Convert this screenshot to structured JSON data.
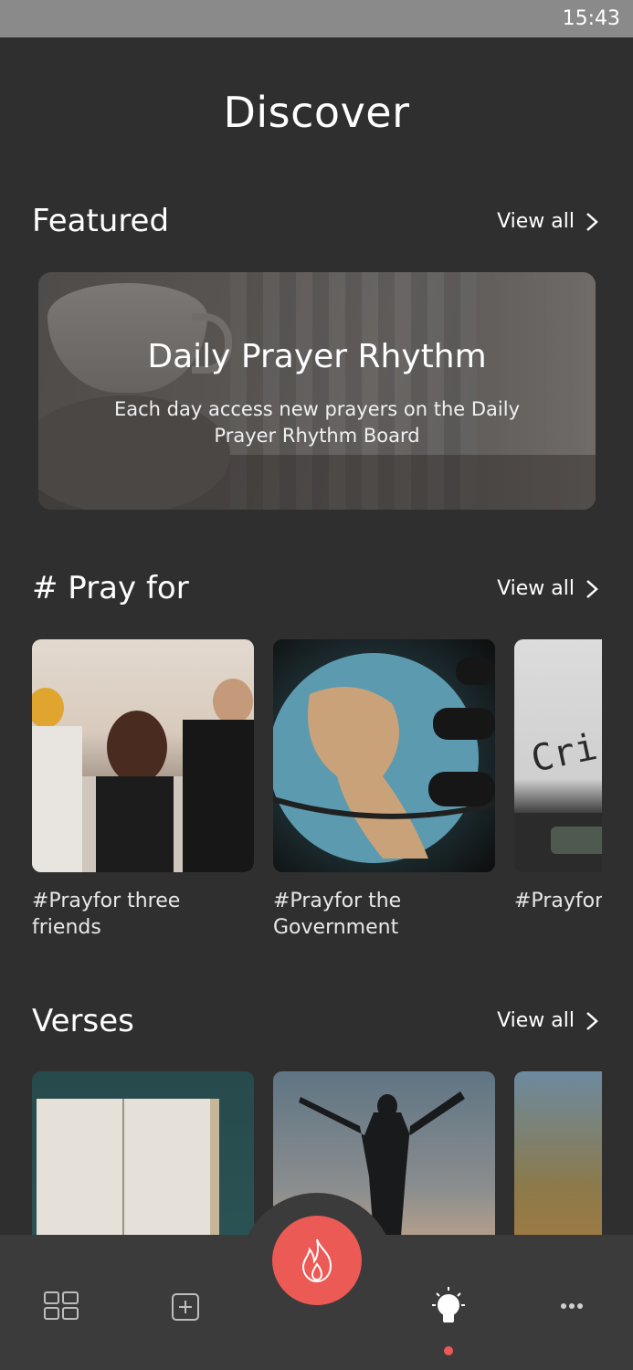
{
  "status_bar": {
    "time": "15:43"
  },
  "page": {
    "title": "Discover"
  },
  "featured": {
    "title": "Featured",
    "view_all": "View all",
    "card": {
      "title": "Daily Prayer Rhythm",
      "subtitle": "Each day access new prayers on the Daily Prayer Rhythm Board"
    }
  },
  "pray_for": {
    "title": "# Pray for",
    "view_all": "View all",
    "items": [
      {
        "label": "#Prayfor three friends"
      },
      {
        "label": "#Prayfor the Government"
      },
      {
        "label": "#Prayfor situations"
      }
    ]
  },
  "verses": {
    "title": "Verses",
    "view_all": "View all"
  },
  "nav": {
    "items": [
      "grid-icon",
      "add-icon",
      "fire-icon",
      "lightbulb-icon",
      "more-icon"
    ],
    "accent": "#ec5a55"
  }
}
